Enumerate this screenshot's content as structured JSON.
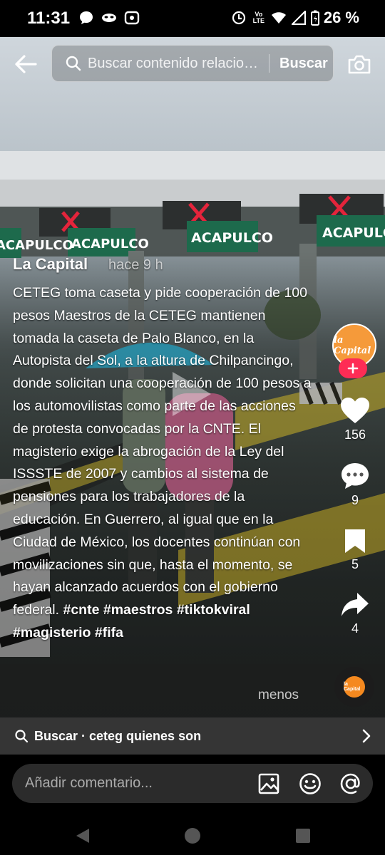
{
  "status_bar": {
    "time": "11:31",
    "battery": "26 %",
    "network": "Vo LTE"
  },
  "search": {
    "placeholder": "Buscar contenido relacionado",
    "button_label": "Buscar"
  },
  "post": {
    "author": "La Capital",
    "time_ago": "hace 9 h",
    "caption": "CETEG toma caseta y pide cooperación de 100 pesos Maestros de la CETEG mantienen tomada la caseta de Palo Blanco, en la Autopista del Sol, a la altura de Chilpancingo, donde solicitan una cooperación de 100 pesos a los automovilistas como parte de las acciones de protesta convocadas por la CNTE. El magisterio exige la abrogación de la Ley del ISSSTE de 2007 y cambios al sistema de pensiones para los trabajadores de la educación. En Guerrero, al igual que en la Ciudad de México, los docentes continúan con movilizaciones sin que, hasta el momento, se hayan alcanzado acuerdos con el gobierno federal.",
    "hashtags": [
      "#cnte",
      "#maestros",
      "#tiktokviral",
      "#magisterio",
      "#fifa"
    ],
    "less_label": "menos"
  },
  "scene_signs": [
    "ACAPULCO",
    "ACAPULCO",
    "ACAPULCO",
    "ACAPULCO"
  ],
  "actions": {
    "likes": "156",
    "comments": "9",
    "saves": "5",
    "shares": "4"
  },
  "avatar_text": "la Capital",
  "related_search": {
    "prefix": "Buscar",
    "separator": " · ",
    "query": "ceteg quienes son"
  },
  "comment": {
    "placeholder": "Añadir comentario..."
  },
  "colors": {
    "follow": "#fe2c55",
    "avatar": "#f59a3a"
  }
}
